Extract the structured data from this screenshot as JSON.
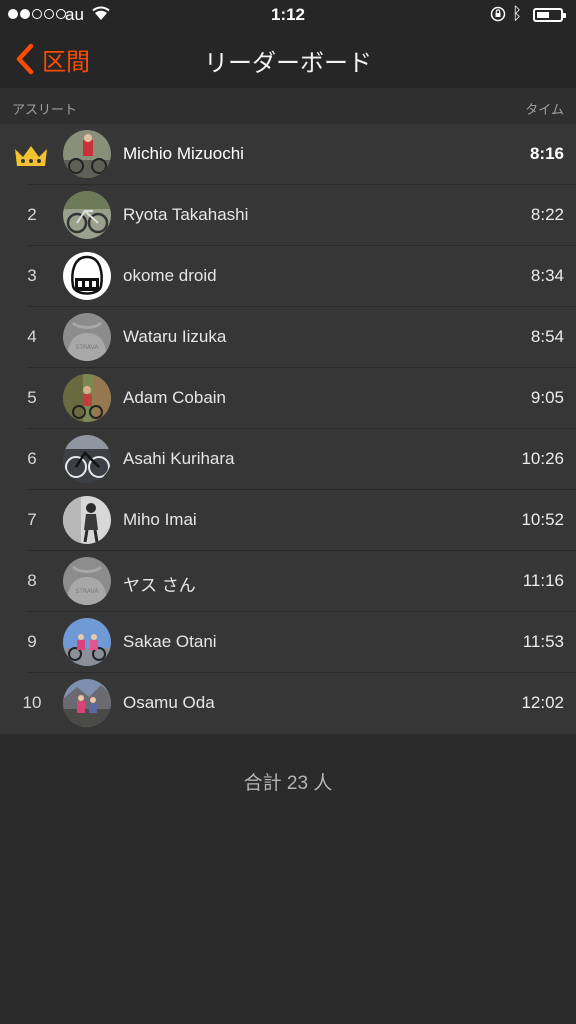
{
  "status_bar": {
    "carrier": "au",
    "time": "1:12"
  },
  "nav": {
    "back_label": "区間",
    "title": "リーダーボード"
  },
  "columns": {
    "athlete": "アスリート",
    "time": "タイム"
  },
  "leaderboard": [
    {
      "rank": "",
      "name": "Michio Mizuochi",
      "time": "8:16",
      "avatar": "cyclist-photo-red",
      "crown": true
    },
    {
      "rank": "2",
      "name": "Ryota Takahashi",
      "time": "8:22",
      "avatar": "bicycle-photo"
    },
    {
      "rank": "3",
      "name": "okome droid",
      "time": "8:34",
      "avatar": "rice-ball-drawing"
    },
    {
      "rank": "4",
      "name": "Wataru Iizuka",
      "time": "8:54",
      "avatar": "strava-default"
    },
    {
      "rank": "5",
      "name": "Adam Cobain",
      "time": "9:05",
      "avatar": "cyclist-photo-trail"
    },
    {
      "rank": "6",
      "name": "Asahi Kurihara",
      "time": "10:26",
      "avatar": "bicycle-photo-dark"
    },
    {
      "rank": "7",
      "name": "Miho Imai",
      "time": "10:52",
      "avatar": "person-photo-grey"
    },
    {
      "rank": "8",
      "name": "ヤス さん",
      "time": "11:16",
      "avatar": "strava-default"
    },
    {
      "rank": "9",
      "name": "Sakae Otani",
      "time": "11:53",
      "avatar": "cyclists-photo-sky"
    },
    {
      "rank": "10",
      "name": "Osamu Oda",
      "time": "12:02",
      "avatar": "cyclists-photo-mountain"
    }
  ],
  "total": "合計 23 人",
  "colors": {
    "accent": "#fc4c02",
    "background": "#2b2b2b",
    "row_background": "#363636",
    "crown": "#f2c230"
  }
}
